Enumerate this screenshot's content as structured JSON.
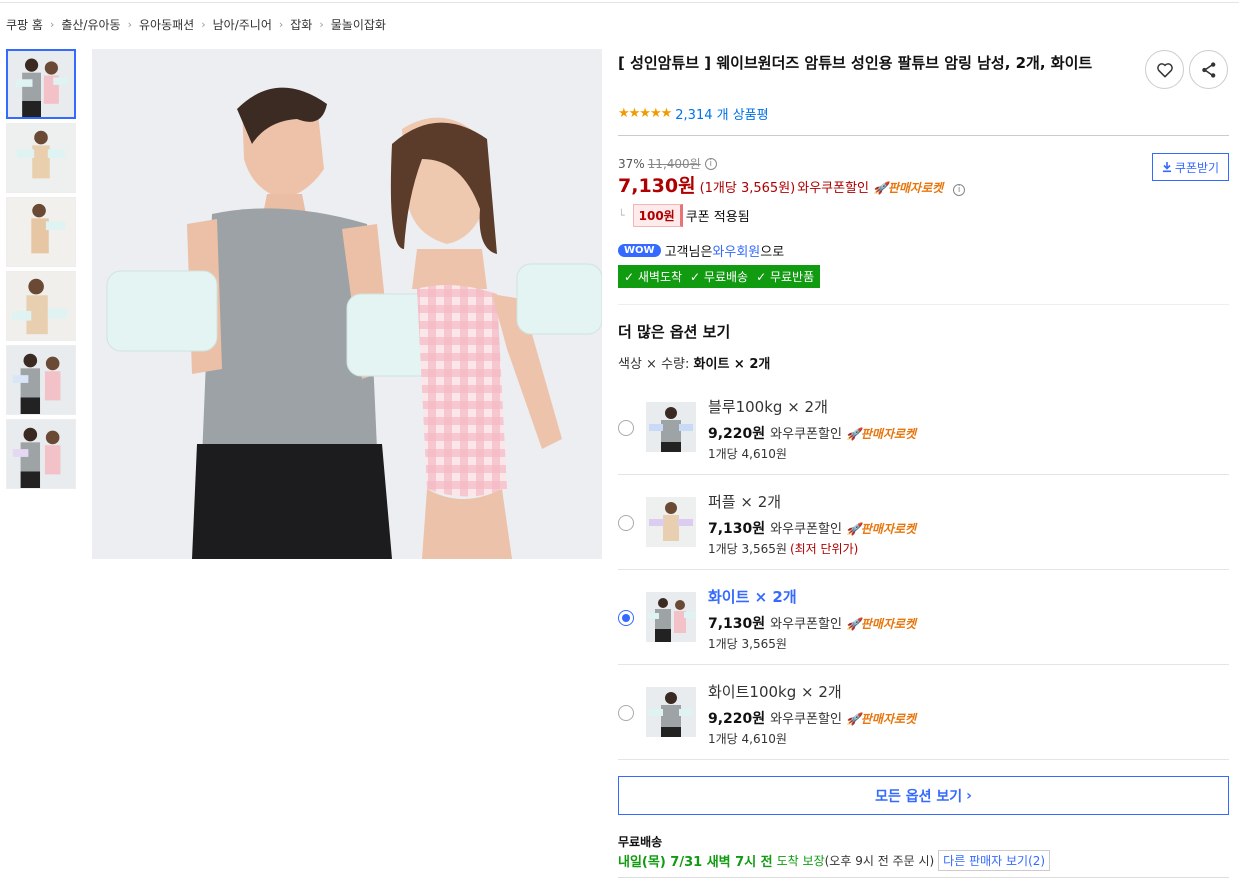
{
  "breadcrumb": [
    "쿠팡 홈",
    "출산/유아동",
    "유아동패션",
    "남아/주니어",
    "잡화",
    "물놀이잡화"
  ],
  "product": {
    "title": "[ 성인암튜브 ] 웨이브원더즈 암튜브 성인용 팔튜브 암링 남성, 2개, 화이트",
    "stars": "★★★★★",
    "rating": 5,
    "review_count": "2,314 개 상품평"
  },
  "icons": {
    "wishlist": "heart-icon",
    "share": "share-icon",
    "info": "info-icon",
    "download": "download-icon",
    "rocket": "rocket-icon",
    "check": "check-icon",
    "chevron": "chevron-right-icon"
  },
  "price": {
    "discount_rate": "37%",
    "original": "11,400원",
    "sale": "7,130원",
    "unit_price": "(1개당 3,565원)",
    "wow_label": "와우쿠폰할인",
    "rocket_label": "판매자로켓",
    "coupon_button": "쿠폰받기",
    "coupon_amount": "100원",
    "coupon_applied": "쿠폰 적용됨"
  },
  "wow": {
    "badge": "WOW",
    "text_prefix": "고객님은",
    "member": "와우회원",
    "text_suffix": "으로",
    "benefits": [
      "새벽도착",
      "무료배송",
      "무료반품"
    ]
  },
  "options": {
    "title": "더 많은 옵션 보기",
    "summary_prefix": "색상 × 수량:",
    "summary_value": "화이트 × 2개",
    "items": [
      {
        "name": "블루100kg × 2개",
        "price": "9,220원",
        "wow": "와우쿠폰할인",
        "rocket": "판매자로켓",
        "unit": "1개당 4,610원",
        "lowest": "",
        "selected": false
      },
      {
        "name": "퍼플 × 2개",
        "price": "7,130원",
        "wow": "와우쿠폰할인",
        "rocket": "판매자로켓",
        "unit": "1개당 3,565원",
        "lowest": "(최저 단위가)",
        "selected": false
      },
      {
        "name": "화이트 × 2개",
        "price": "7,130원",
        "wow": "와우쿠폰할인",
        "rocket": "판매자로켓",
        "unit": "1개당 3,565원",
        "lowest": "",
        "selected": true
      },
      {
        "name": "화이트100kg × 2개",
        "price": "9,220원",
        "wow": "와우쿠폰할인",
        "rocket": "판매자로켓",
        "unit": "1개당 4,610원",
        "lowest": "",
        "selected": false
      }
    ],
    "all_button": "모든 옵션 보기"
  },
  "shipping": {
    "label": "무료배송",
    "date": "내일(목) 7/31 새벽 7시 전",
    "guarantee": "도착 보장",
    "condition": "(오후 9시 전 주문 시)",
    "other_sellers": "다른 판매자 보기(2)"
  },
  "colors": {
    "accent": "#346aff",
    "price_red": "#ae0000",
    "rocket_orange": "#e8760c",
    "benefit_green": "#119b11",
    "star": "#f29b00"
  }
}
